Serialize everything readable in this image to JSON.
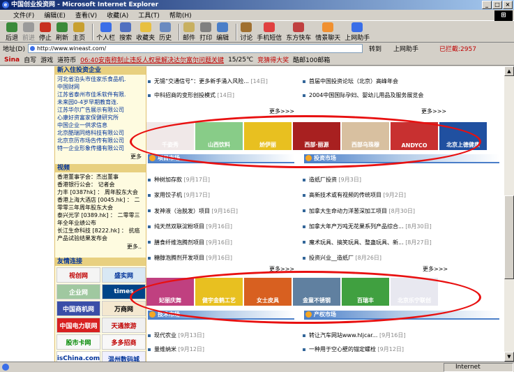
{
  "window": {
    "title": "中国创业投资网 - Microsoft Internet Explorer",
    "buttons": [
      "_",
      "□",
      "×"
    ]
  },
  "menu": [
    "文件(F)",
    "编辑(E)",
    "查看(V)",
    "收藏(A)",
    "工具(T)",
    "帮助(H)"
  ],
  "toolbar": [
    {
      "label": "后退",
      "color": "#3a8a3a",
      "disabled": false
    },
    {
      "label": "前进",
      "color": "#9a9a9a",
      "disabled": true
    },
    {
      "label": "停止",
      "color": "#c83020",
      "disabled": false
    },
    {
      "label": "刷新",
      "color": "#3a8a3a",
      "disabled": false
    },
    {
      "label": "主页",
      "color": "#c8a030",
      "disabled": false
    },
    {
      "label": "个人栏",
      "color": "#3a6ee8",
      "disabled": false
    },
    {
      "label": "搜索",
      "color": "#5070c0",
      "disabled": false
    },
    {
      "label": "收藏夹",
      "color": "#e8c040",
      "disabled": false
    },
    {
      "label": "历史",
      "color": "#6a8ac0",
      "disabled": false
    },
    {
      "label": "邮件",
      "color": "#c8b060",
      "disabled": false
    },
    {
      "label": "打印",
      "color": "#808080",
      "disabled": false
    },
    {
      "label": "编辑",
      "color": "#4a7ec8",
      "disabled": false
    },
    {
      "label": "讨论",
      "color": "#a07030",
      "disabled": false
    },
    {
      "label": "手机短信",
      "color": "#e04040",
      "disabled": false
    },
    {
      "label": "东方快车",
      "color": "#c04040",
      "disabled": false
    },
    {
      "label": "情景聊天",
      "color": "#f09030",
      "disabled": false
    },
    {
      "label": "上网助手",
      "color": "#3a6ee8",
      "disabled": false
    }
  ],
  "address": {
    "label": "地址(D)",
    "url": "http://www.wineast.com/",
    "go": "转到",
    "assistant": "上网助手",
    "blocked": "已拦截:2957"
  },
  "links": {
    "items": [
      "Sina",
      "自写",
      "游戏",
      "道符币"
    ],
    "ticker": "06:40安南称制止违反人权是解决达尔富尔问题关键",
    "weather": "15/25℃",
    "chat": "竞猜得大奖",
    "mail": "酷邮100邮箱"
  },
  "left": {
    "sect1": {
      "title": "新入住投资企业",
      "items": [
        "河北省泊头市佳家乐食品机.",
        "中国财网",
        "江苏省泰州市佳禾软件有限.",
        "未来园0-4岁早期教育连.",
        "江苏华尔广告展示有限公司",
        "心康好资富家保健研究所",
        "中国企业一供求信息",
        "北京酷瑞同络科技有限公司",
        "北京京历市场告传有限公司",
        "特一企业形象传播有限公司"
      ],
      "more": "更多"
    },
    "sect2": {
      "title": "视频",
      "items": [
        "香港董事学会：杰出董事",
        "香港银行公会： 记者会",
        "力丰 [0387hk] ： 周年股东大会",
        "香港上海大酒店 [0045.hk] ： 二零零三年周年股东大会",
        "泰兴光学 [0389.hk] ： 二零零三年全年业绩公布",
        "长江生命科技 [8222.hk] ： 抗癌产品试验结果发布会"
      ],
      "more": "更多.."
    },
    "sect3": {
      "title": "友情连接",
      "links": [
        {
          "text": "视创网",
          "bg": "#f4f4f4",
          "fg": "#c00000"
        },
        {
          "text": "盛实网",
          "bg": "#d8e8f4",
          "fg": "#003399"
        },
        {
          "text": "企业网",
          "bg": "#a0c8a0",
          "fg": "#fff"
        },
        {
          "text": "times",
          "bg": "#004488",
          "fg": "#fff"
        },
        {
          "text": "中国商机网",
          "bg": "#3a4ea8",
          "fg": "#fff"
        },
        {
          "text": "万商网",
          "bg": "#f4e8d0",
          "fg": "#000"
        },
        {
          "text": "中国电力联网",
          "bg": "#d82020",
          "fg": "#fff"
        },
        {
          "text": "天通旅游",
          "bg": "#f0f0f0",
          "fg": "#c00000"
        },
        {
          "text": "股市卡网",
          "bg": "#f8f8f8",
          "fg": "#008800"
        },
        {
          "text": "多多招商",
          "bg": "#f8f8f8",
          "fg": "#c00000"
        },
        {
          "text": "isChina.com",
          "bg": "#fff",
          "fg": "#003399"
        },
        {
          "text": "温州数码城",
          "bg": "#f0f0ff",
          "fg": "#003399"
        }
      ]
    }
  },
  "top_news": {
    "left": [
      {
        "t": "无锡“交通信号”：更多新手涌入风险...",
        "d": "[14日]"
      },
      {
        "t": "中科招商的变形创投模式",
        "d": "[14日]"
      }
    ],
    "right": [
      {
        "t": "首届中国投资论坛（北京）高峰年会",
        "d": ""
      },
      {
        "t": "2004中国国际孕妇、婴幼儿用品及服务展览会",
        "d": ""
      }
    ],
    "more": "更多>>>"
  },
  "ads1": [
    {
      "text": "千姿秀",
      "bg": "#f0e8e8"
    },
    {
      "text": "山西饮料",
      "bg": "#88cc88"
    },
    {
      "text": "娇伊丽",
      "bg": "#e8c020"
    },
    {
      "text": "西部·丽源",
      "bg": "#a82020"
    },
    {
      "text": "西部乌珠穆",
      "bg": "#d8c0a0"
    },
    {
      "text": "ANDYCO",
      "bg": "#c83030"
    },
    {
      "text": "北京上德健康",
      "bg": "#2050a0"
    }
  ],
  "tabs1": {
    "left": "项目市场",
    "right": "投资市场"
  },
  "mid_news": {
    "left": [
      {
        "t": "种树加存款",
        "d": "[9月17日]"
      },
      {
        "t": "家用饺子机",
        "d": "[9月17日]"
      },
      {
        "t": "发神液（治脱发）项目",
        "d": "[9月16日]"
      },
      {
        "t": "纯天然双联淀粉项目",
        "d": "[9月16日]"
      },
      {
        "t": "膳食纤维泡腾剂项目",
        "d": "[9月16日]"
      },
      {
        "t": "糖醇泡腾剂开发项目",
        "d": "[9月16日]"
      }
    ],
    "right": [
      {
        "t": "造纸厂投资",
        "d": "[9月3日]"
      },
      {
        "t": "高新技术或有视频的传统项目",
        "d": "[9月2日]"
      },
      {
        "t": "加拿大生命动力洋葱深加工项目",
        "d": "[8月30日]"
      },
      {
        "t": "加拿大年产万吨无花果系列产品综合...",
        "d": "[8月30日]"
      },
      {
        "t": "魔术玩具、搞笑玩具、整蛊玩具、新...",
        "d": "[8月27日]"
      },
      {
        "t": "投资兴业__造纸厂",
        "d": "[8月26日]"
      }
    ],
    "more": "更多>>>"
  },
  "ads2": [
    {
      "text": "妃丽庆舞",
      "bg": "#c04080"
    },
    {
      "text": "健宇金鹤工艺",
      "bg": "#e8c020"
    },
    {
      "text": "女士皮具",
      "bg": "#d86020"
    },
    {
      "text": "金童不锈钢",
      "bg": "#6080a0"
    },
    {
      "text": "百瑞丰",
      "bg": "#40a040"
    },
    {
      "text": "北京乐宁联创",
      "bg": "#e8e8f0"
    }
  ],
  "tabs2": {
    "left": "技术市场",
    "right": "产权市场"
  },
  "bottom_news": {
    "left": [
      {
        "t": "现代农业",
        "d": "[9月13日]"
      },
      {
        "t": "量维纳米",
        "d": "[9月12日]"
      }
    ],
    "right": [
      {
        "t": "转让汽车网站www.hljcar...",
        "d": "[9月16日]"
      },
      {
        "t": "一种用于空心壁的锚定螺栓",
        "d": "[9月12日]"
      }
    ]
  },
  "status": {
    "zone": "Internet"
  }
}
